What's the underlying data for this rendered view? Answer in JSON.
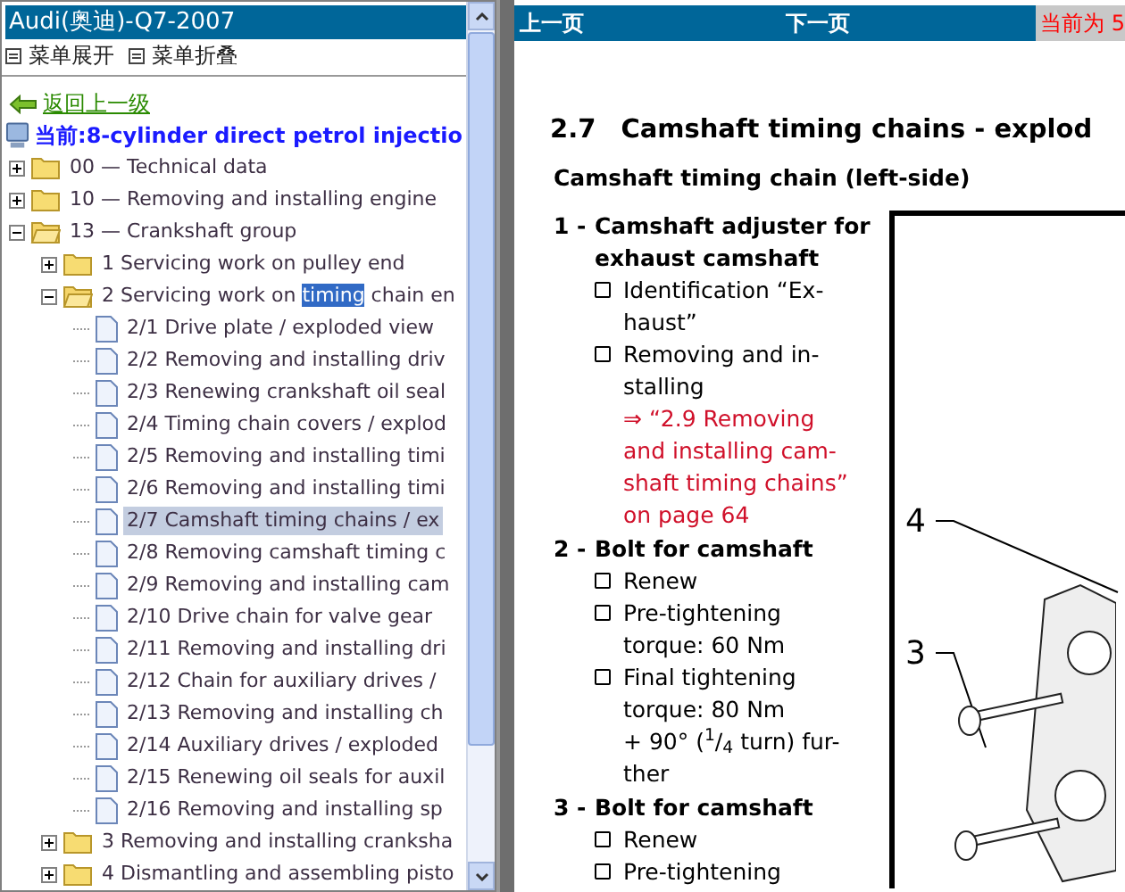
{
  "sidebar": {
    "title": "Audi(奥迪)-Q7-2007",
    "toolbar": [
      "菜单展开",
      "菜单折叠"
    ],
    "back_link": "返回上一级",
    "current": "当前:8-cylinder direct petrol injectio",
    "tree": [
      {
        "kind": "folder",
        "label": "00 — Technical data",
        "expanded": false,
        "selected": false
      },
      {
        "kind": "folder",
        "label": "10 — Removing and installing engine",
        "expanded": false,
        "selected": false
      },
      {
        "kind": "folder",
        "label": "13 — Crankshaft group",
        "expanded": true,
        "selected": false,
        "children": [
          {
            "kind": "folder",
            "label": "1 Servicing work on pulley end",
            "expanded": false,
            "selected": false
          },
          {
            "kind": "folder",
            "parts": [
              {
                "text": "2 Servicing work on ",
                "highlighted": false
              },
              {
                "text": "timing",
                "highlighted": true
              },
              {
                "text": " chain en",
                "highlighted": false
              }
            ],
            "expanded": true,
            "selected": false,
            "children": [
              {
                "kind": "document",
                "label": "2/1 Drive plate / exploded view",
                "selected": false
              },
              {
                "kind": "document",
                "label": "2/2 Removing and installing driv",
                "selected": false
              },
              {
                "kind": "document",
                "label": "2/3 Renewing crankshaft oil seal",
                "selected": false
              },
              {
                "kind": "document",
                "label": "2/4 Timing chain covers / explod",
                "selected": false
              },
              {
                "kind": "document",
                "label": "2/5 Removing and installing timi",
                "selected": false
              },
              {
                "kind": "document",
                "label": "2/6 Removing and installing timi",
                "selected": false
              },
              {
                "kind": "document",
                "label": "2/7 Camshaft timing chains / ex",
                "selected": true
              },
              {
                "kind": "document",
                "label": "2/8 Removing camshaft timing c",
                "selected": false
              },
              {
                "kind": "document",
                "label": "2/9 Removing and installing cam",
                "selected": false
              },
              {
                "kind": "document",
                "label": "2/10 Drive chain for valve gear",
                "selected": false
              },
              {
                "kind": "document",
                "label": "2/11 Removing and installing dri",
                "selected": false
              },
              {
                "kind": "document",
                "label": "2/12 Chain for auxiliary drives /",
                "selected": false
              },
              {
                "kind": "document",
                "label": "2/13 Removing and installing ch",
                "selected": false
              },
              {
                "kind": "document",
                "label": "2/14 Auxiliary drives / exploded",
                "selected": false
              },
              {
                "kind": "document",
                "label": "2/15 Renewing oil seals for auxil",
                "selected": false
              },
              {
                "kind": "document",
                "label": "2/16 Removing and installing sp",
                "selected": false
              }
            ]
          },
          {
            "kind": "folder",
            "label": "3 Removing and installing cranksha",
            "expanded": false,
            "selected": false
          },
          {
            "kind": "folder",
            "label": "4 Dismantling and assembling pisto",
            "expanded": false,
            "selected": false
          }
        ]
      }
    ]
  },
  "viewer": {
    "nav": {
      "previous": "上一页",
      "next": "下一页",
      "page_indicator": "当前为 5"
    },
    "heading_number": "2.7",
    "heading": "Camshaft timing chains - explod",
    "subheading": "Camshaft timing chain (left-side)",
    "items": [
      {
        "number": "1 -",
        "title": [
          "Camshaft adjuster for",
          "exhaust camshaft"
        ],
        "notes": [
          {
            "lines": [
              "Identification “Ex-",
              "haust”"
            ]
          },
          {
            "lines": [
              "Removing and in-",
              "stalling"
            ],
            "link": [
              "⇒ “2.9 Removing",
              "and installing cam-",
              "shaft timing chains”",
              "on page 64"
            ]
          }
        ]
      },
      {
        "number": "2 -",
        "title": [
          "Bolt for camshaft"
        ],
        "notes": [
          {
            "lines": [
              "Renew"
            ]
          },
          {
            "lines": [
              "Pre-tightening",
              "torque: 60 Nm"
            ]
          },
          {
            "lines": [
              "Final tightening",
              "torque: 80 Nm",
              "+ 90° ($^{1}$/$_{4}$ turn) fur-",
              "ther"
            ]
          }
        ]
      },
      {
        "number": "3 -",
        "title": [
          "Bolt for camshaft"
        ],
        "notes": [
          {
            "lines": [
              "Renew"
            ]
          },
          {
            "lines": [
              "Pre-tightening"
            ]
          }
        ]
      }
    ],
    "callouts": [
      "4",
      "3"
    ]
  }
}
